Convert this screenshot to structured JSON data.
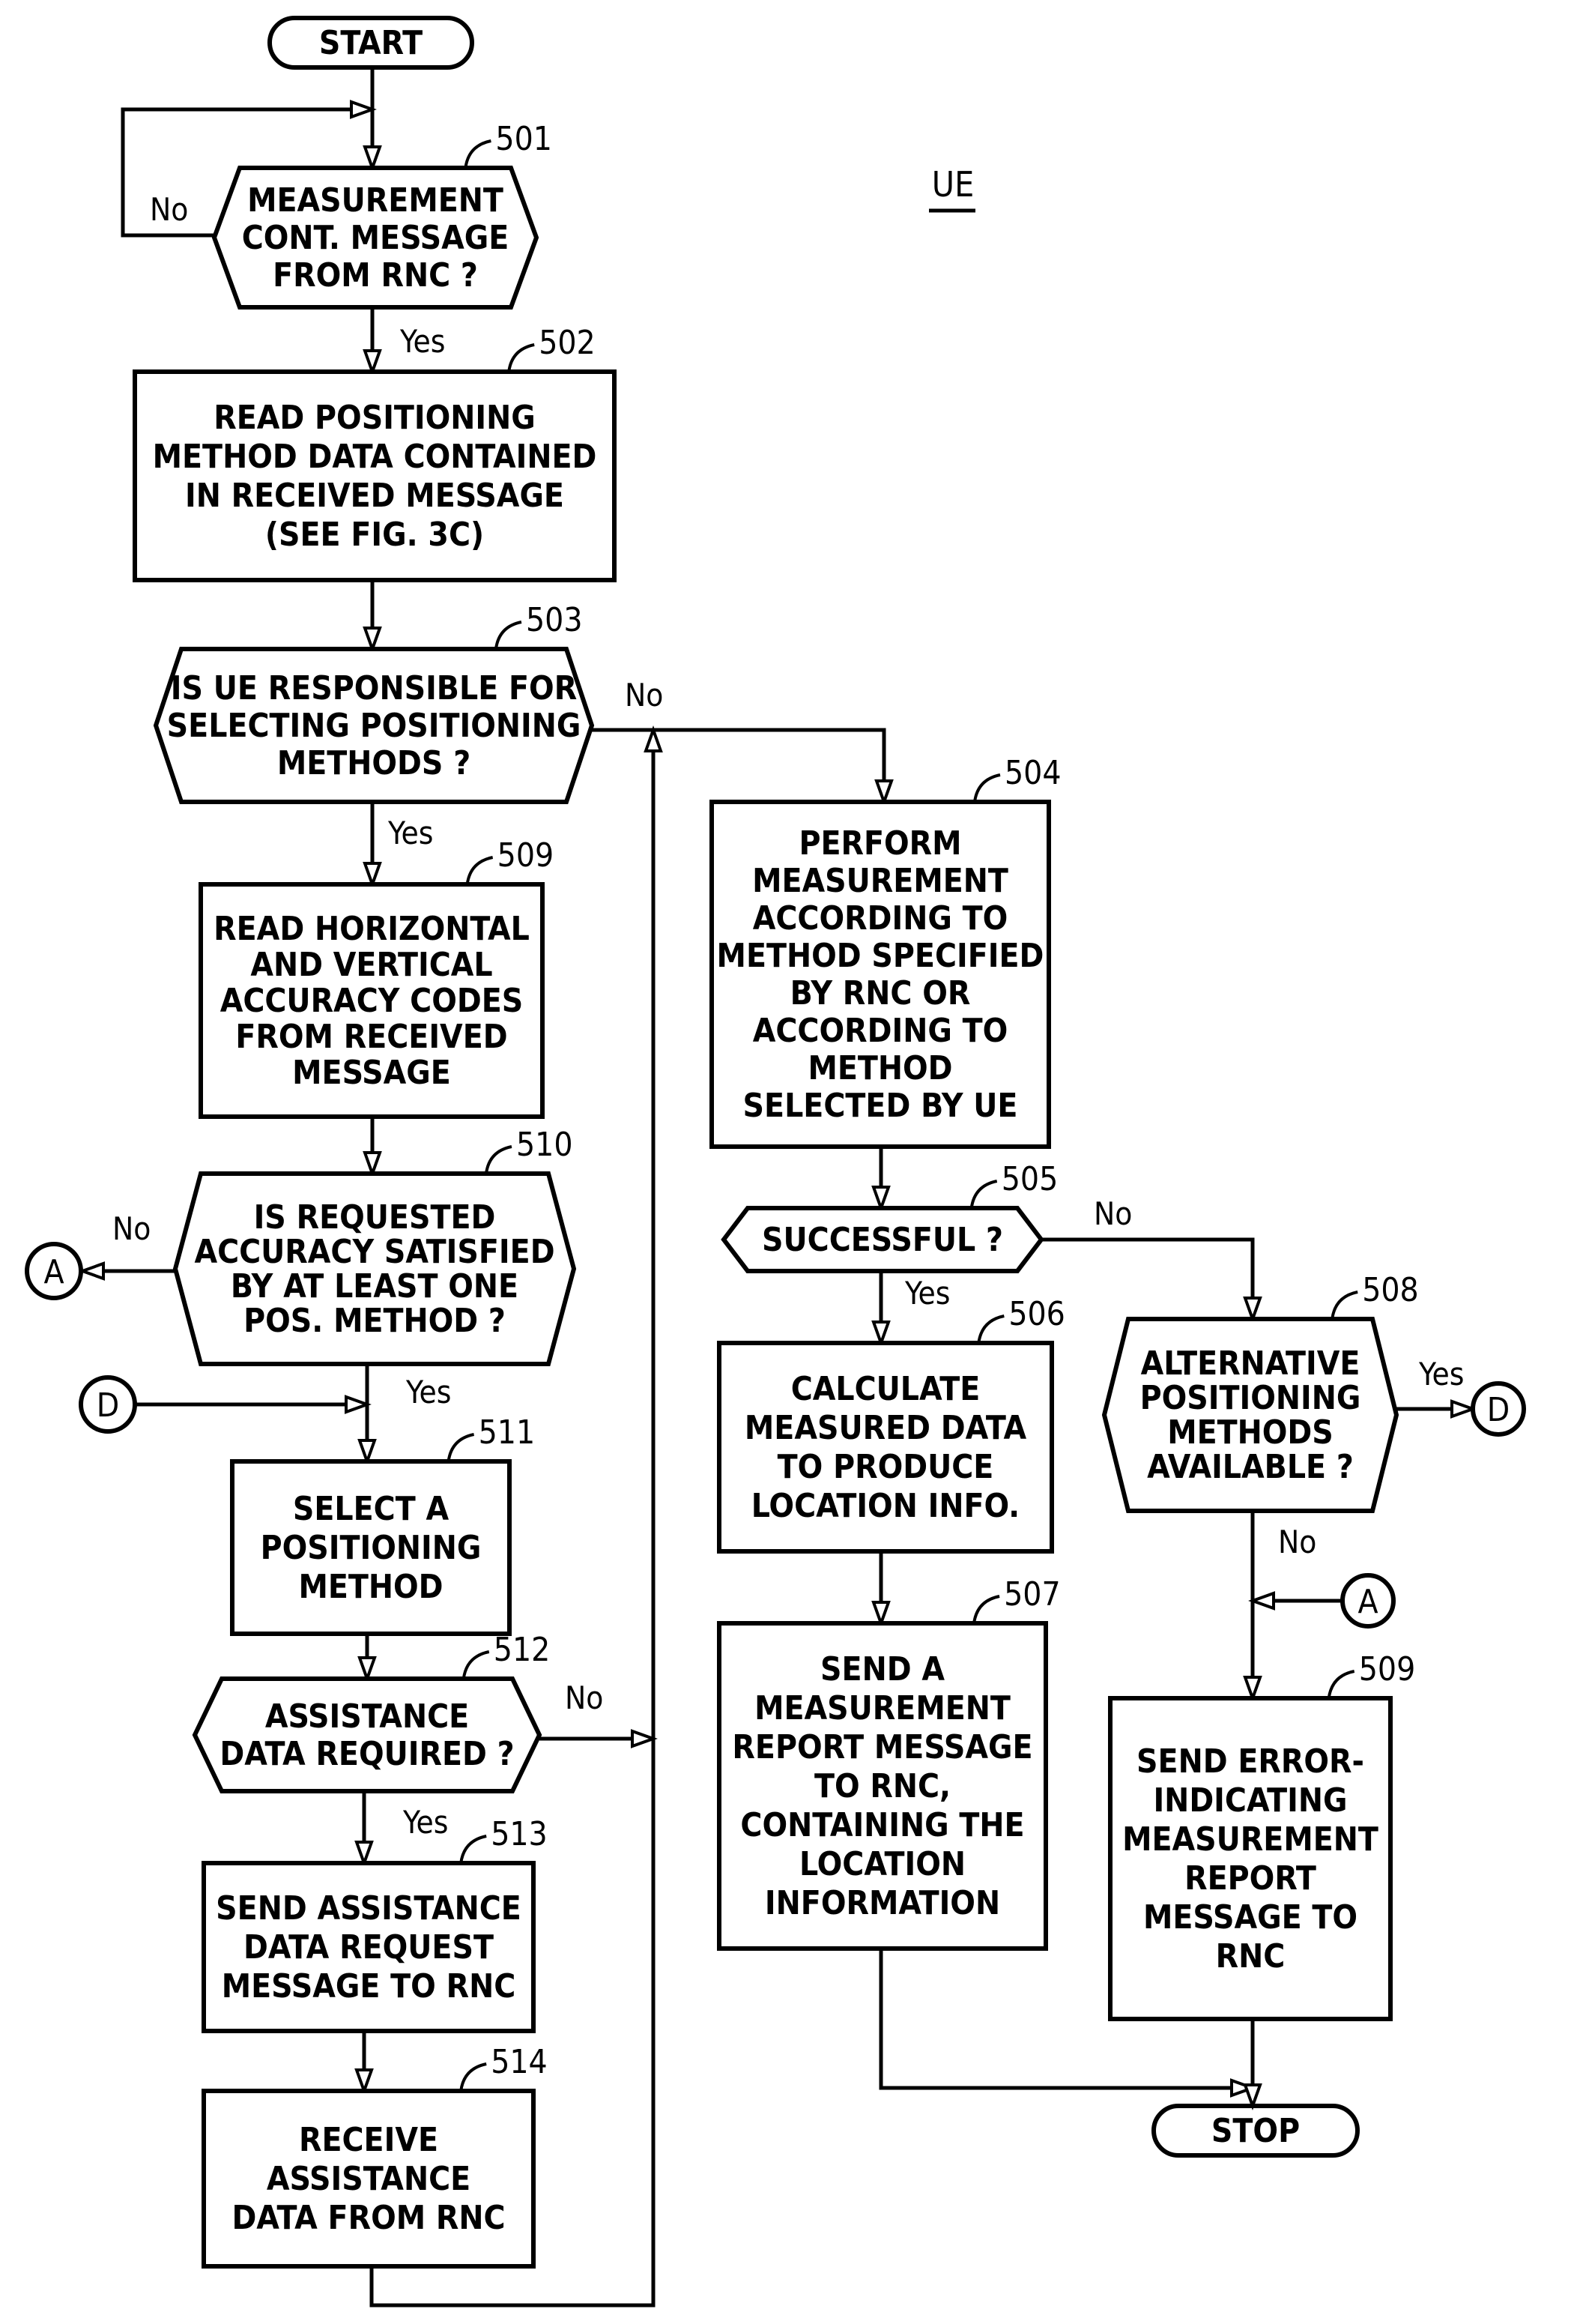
{
  "figure": {
    "title": "UE",
    "terminals": {
      "start": "START",
      "stop": "STOP"
    },
    "steps": [
      {
        "id": "501",
        "type": "decision",
        "ref": "501",
        "lines": [
          "MEASUREMENT",
          "CONT. MESSAGE",
          "FROM RNC ?"
        ]
      },
      {
        "id": "502",
        "type": "process",
        "ref": "502",
        "lines": [
          "READ POSITIONING",
          "METHOD DATA CONTAINED",
          "IN RECEIVED MESSAGE",
          "(SEE FIG. 3C)"
        ]
      },
      {
        "id": "503",
        "type": "decision",
        "ref": "503",
        "lines": [
          "IS UE RESPONSIBLE FOR",
          "SELECTING POSITIONING",
          "METHODS ?"
        ]
      },
      {
        "id": "509a",
        "type": "process",
        "ref": "509",
        "lines": [
          "READ HORIZONTAL",
          "AND VERTICAL",
          "ACCURACY CODES",
          "FROM RECEIVED",
          "MESSAGE"
        ]
      },
      {
        "id": "510",
        "type": "decision",
        "ref": "510",
        "lines": [
          "IS REQUESTED",
          "ACCURACY SATISFIED",
          "BY AT LEAST ONE",
          "POS. METHOD ?"
        ]
      },
      {
        "id": "511",
        "type": "process",
        "ref": "511",
        "lines": [
          "SELECT A",
          "POSITIONING",
          "METHOD"
        ]
      },
      {
        "id": "512",
        "type": "decision",
        "ref": "512",
        "lines": [
          "ASSISTANCE",
          "DATA REQUIRED ?"
        ]
      },
      {
        "id": "513",
        "type": "process",
        "ref": "513",
        "lines": [
          "SEND ASSISTANCE",
          "DATA REQUEST",
          "MESSAGE TO RNC"
        ]
      },
      {
        "id": "514",
        "type": "process",
        "ref": "514",
        "lines": [
          "RECEIVE",
          "ASSISTANCE",
          "DATA FROM RNC"
        ]
      },
      {
        "id": "504",
        "type": "process",
        "ref": "504",
        "lines": [
          "PERFORM",
          "MEASUREMENT",
          "ACCORDING TO",
          "METHOD SPECIFIED",
          "BY RNC OR",
          "ACCORDING TO",
          "METHOD",
          "SELECTED BY UE"
        ]
      },
      {
        "id": "505",
        "type": "decision",
        "ref": "505",
        "lines": [
          "SUCCESSFUL ?"
        ]
      },
      {
        "id": "506",
        "type": "process",
        "ref": "506",
        "lines": [
          "CALCULATE",
          "MEASURED DATA",
          "TO PRODUCE",
          "LOCATION INFO."
        ]
      },
      {
        "id": "507",
        "type": "process",
        "ref": "507",
        "lines": [
          "SEND A",
          "MEASUREMENT",
          "REPORT MESSAGE",
          "TO RNC,",
          "CONTAINING THE",
          "LOCATION",
          "INFORMATION"
        ]
      },
      {
        "id": "508",
        "type": "decision",
        "ref": "508",
        "lines": [
          "ALTERNATIVE",
          "POSITIONING",
          "METHODS",
          "AVAILABLE ?"
        ]
      },
      {
        "id": "509b",
        "type": "process",
        "ref": "509",
        "lines": [
          "SEND ERROR-",
          "INDICATING",
          "MEASUREMENT",
          "REPORT",
          "MESSAGE TO",
          "RNC"
        ]
      }
    ],
    "branch_labels": {
      "s501_no": "No",
      "s501_yes": "Yes",
      "s503_no": "No",
      "s503_yes": "Yes",
      "s510_no": "No",
      "s510_yes": "Yes",
      "s512_no": "No",
      "s512_yes": "Yes",
      "s505_no": "No",
      "s505_yes": "Yes",
      "s508_yes": "Yes",
      "s508_no": "No"
    },
    "connectors": {
      "a_out": "A",
      "a_in": "A",
      "d_out": "D",
      "d_in": "D"
    }
  }
}
